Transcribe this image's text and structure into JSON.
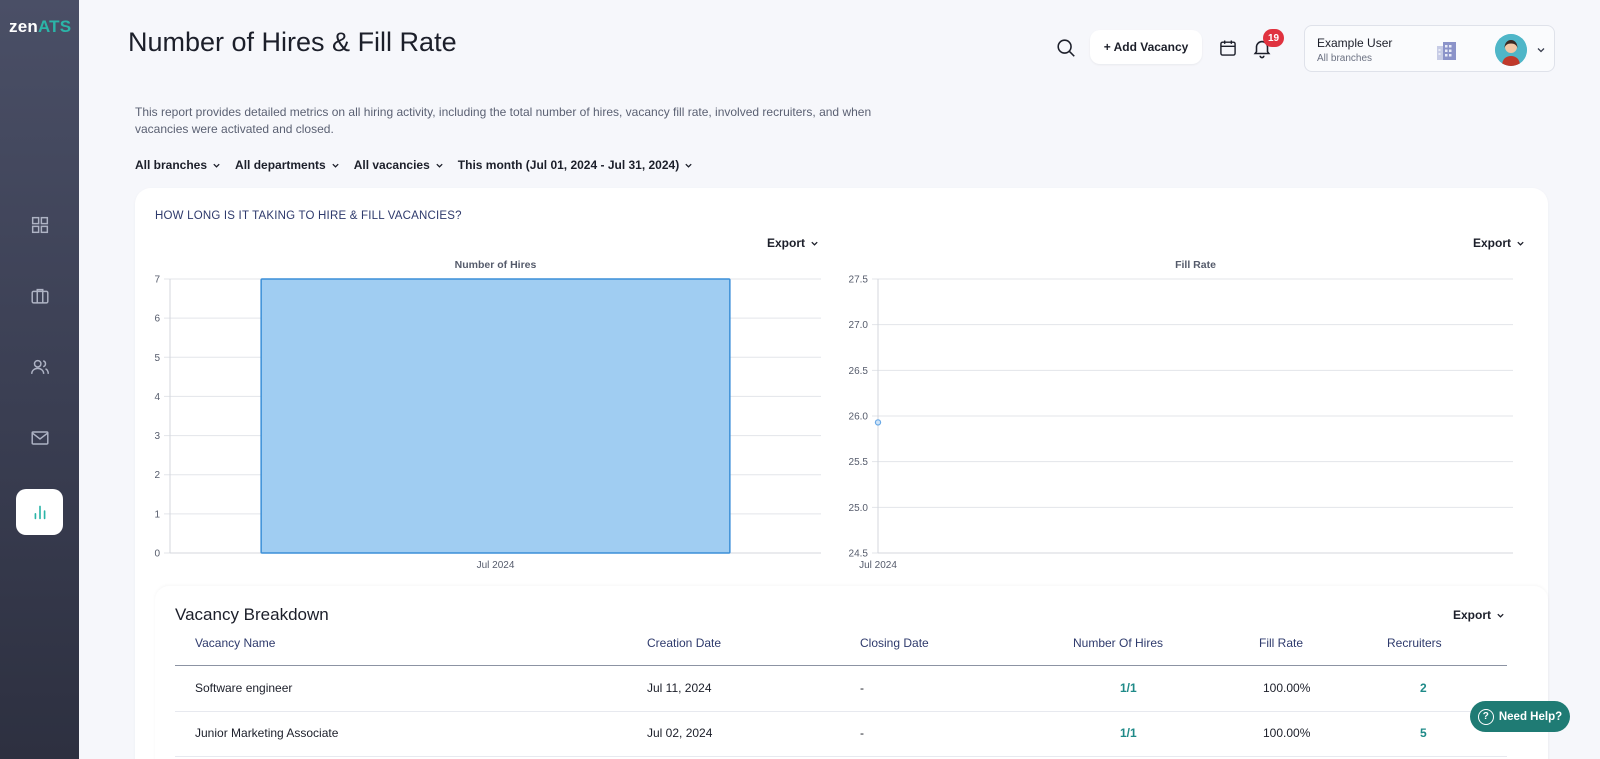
{
  "app": {
    "logo_prefix": "zen",
    "logo_suffix": "ATS"
  },
  "sidebar": {
    "items": [
      {
        "icon": "dashboard-icon"
      },
      {
        "icon": "briefcase-icon"
      },
      {
        "icon": "users-icon"
      },
      {
        "icon": "mail-icon"
      },
      {
        "icon": "bar-chart-icon",
        "active": true
      }
    ]
  },
  "header": {
    "title": "Number of Hires & Fill Rate",
    "add_vacancy_label": "+ Add Vacancy",
    "notification_count": "19",
    "user_name": "Example User",
    "user_scope": "All branches"
  },
  "description": "This report provides detailed metrics on all hiring activity, including the total number of hires, vacancy fill rate, involved recruiters, and when vacancies were activated and closed.",
  "filters": [
    {
      "label": "All branches"
    },
    {
      "label": "All departments"
    },
    {
      "label": "All vacancies"
    },
    {
      "label": "This month (Jul 01, 2024 - Jul 31, 2024)"
    }
  ],
  "card": {
    "question": "HOW LONG IS IT TAKING TO HIRE & FILL VACANCIES?",
    "export_label": "Export"
  },
  "chart_data": [
    {
      "type": "bar",
      "title": "Number of Hires",
      "categories": [
        "Jul 2024"
      ],
      "values": [
        7
      ],
      "ylim": [
        0,
        7
      ],
      "yticks": [
        "0",
        "1",
        "2",
        "3",
        "4",
        "5",
        "6",
        "7"
      ],
      "grid": true,
      "color": "#a0cdf2",
      "border_color": "#3b8fd8"
    },
    {
      "type": "line",
      "title": "Fill Rate",
      "x": [
        "Jul 2024"
      ],
      "values": [
        25.93
      ],
      "ylim": [
        24.5,
        27.5
      ],
      "yticks": [
        "24.5",
        "25.0",
        "25.5",
        "26.0",
        "26.5",
        "27.0",
        "27.5"
      ],
      "grid": true,
      "color": "#6aa9e6"
    }
  ],
  "breakdown": {
    "title": "Vacancy Breakdown",
    "export_label": "Export",
    "columns": [
      "Vacancy Name",
      "Creation Date",
      "Closing Date",
      "Number Of Hires",
      "Fill Rate",
      "Recruiters"
    ],
    "rows": [
      [
        "Software engineer",
        "Jul 11, 2024",
        "-",
        "1/1",
        "100.00%",
        "2"
      ],
      [
        "Junior Marketing Associate",
        "Jul 02, 2024",
        "-",
        "1/1",
        "100.00%",
        "5"
      ]
    ]
  },
  "help": {
    "label": "Need Help?"
  },
  "colors": {
    "accent": "#2bb5a8",
    "link": "#1e8a88",
    "badge": "#e0323f",
    "help": "#1f7b74"
  }
}
